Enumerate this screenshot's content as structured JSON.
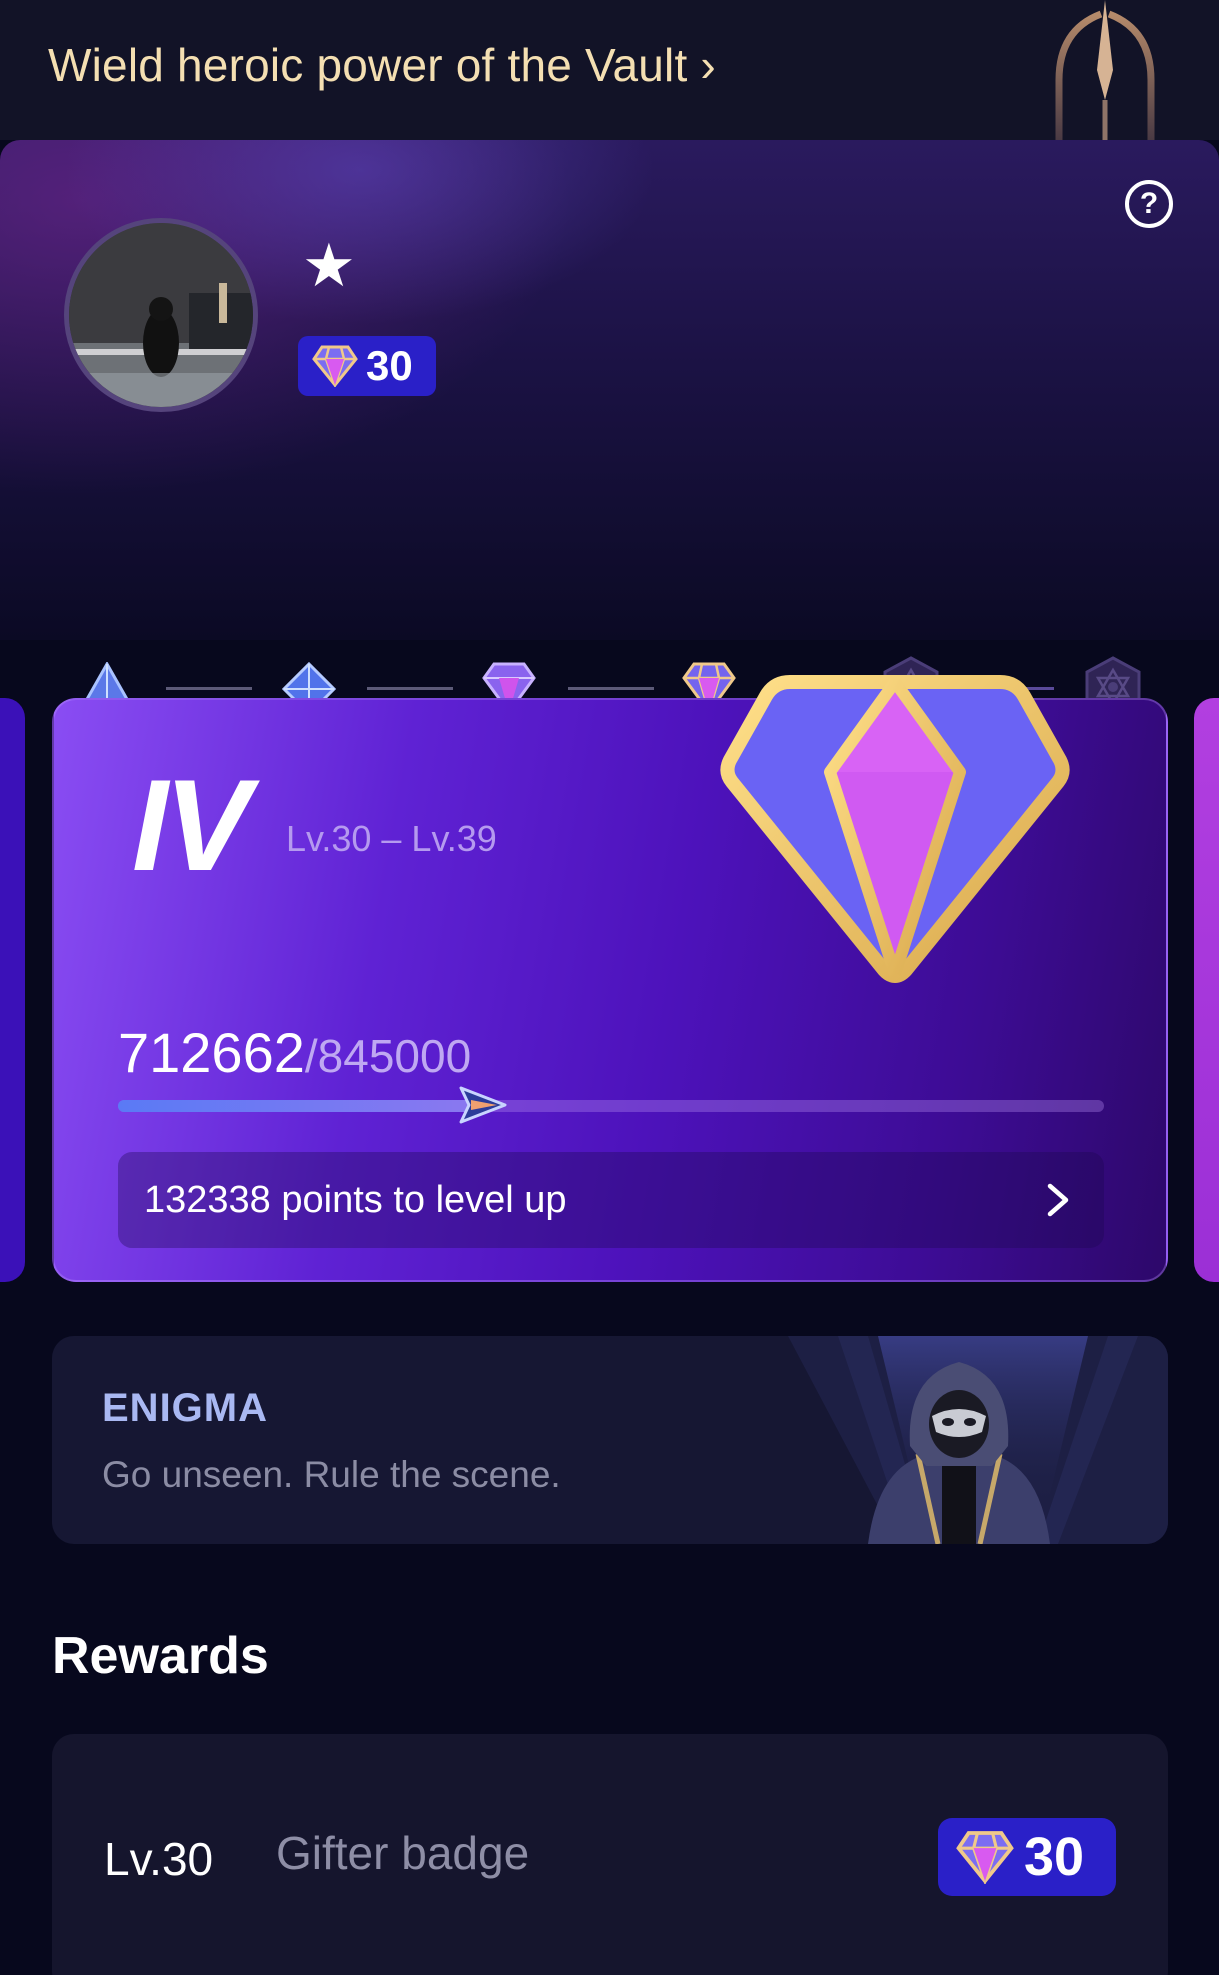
{
  "banner": {
    "text": "Wield heroic power of the Vault ›"
  },
  "profile": {
    "help_glyph": "?",
    "star_glyph": "★",
    "level_badge_value": "30"
  },
  "tiers": {
    "items": [
      "tier-1-icon",
      "tier-2-icon",
      "tier-3-icon",
      "tier-4-icon",
      "tier-5-icon",
      "tier-6-icon"
    ],
    "current_index": 3
  },
  "level_card": {
    "tier_numeral": "IV",
    "level_range": "Lv.30 – Lv.39",
    "points_current": "712662",
    "points_total": "/845000",
    "progress_fraction": 0.3577,
    "levelup_text": "132338 points to level up"
  },
  "enigma": {
    "title": "ENIGMA",
    "subtitle": "Go unseen. Rule the scene."
  },
  "rewards": {
    "heading": "Rewards",
    "items": [
      {
        "level": "Lv.30",
        "name": "Gifter badge",
        "badge_value": "30"
      }
    ]
  },
  "colors": {
    "accent_blue": "#2a20c8",
    "banner_gold": "#f4dfb2",
    "card_purple": "#5f22d4"
  }
}
